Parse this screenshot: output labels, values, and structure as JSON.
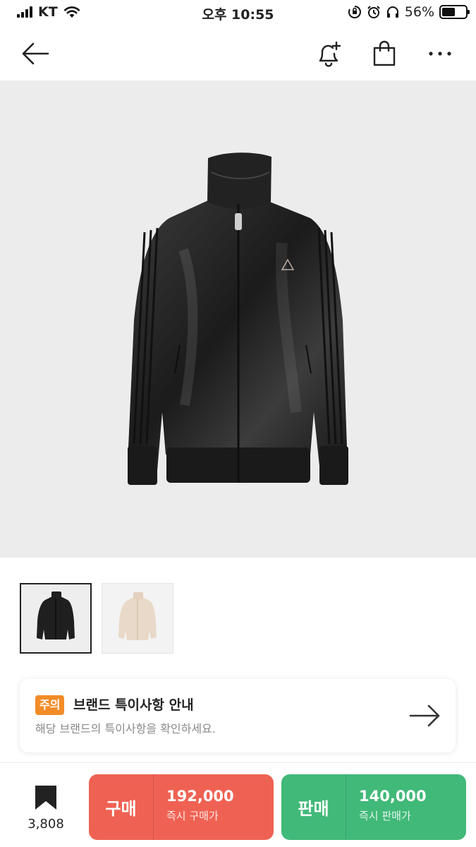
{
  "status_bar": {
    "carrier": "KT",
    "time": "오후 10:55",
    "battery": "56%",
    "battery_level": 0.56
  },
  "nav": {
    "back_icon": "arrow-left-icon",
    "alert_icon": "bell-plus-icon",
    "bag_icon": "shopping-bag-icon",
    "more_icon": "more-horizontal-icon"
  },
  "product": {
    "image_icon": "track-jacket-image",
    "thumbnails": [
      {
        "icon": "black-jacket-thumbnail",
        "selected": true
      },
      {
        "icon": "beige-jacket-thumbnail",
        "selected": false
      }
    ]
  },
  "notice": {
    "badge": "주의",
    "title": "브랜드 특이사항 안내",
    "description": "해당 브랜드의 특이사항을 확인하세요.",
    "arrow_icon": "arrow-right-icon"
  },
  "bottom_bar": {
    "bookmark_icon": "bookmark-icon",
    "bookmark_count": "3,808",
    "buy": {
      "label": "구매",
      "price": "192,000",
      "sub": "즉시 구매가",
      "color": "#ef6253"
    },
    "sell": {
      "label": "판매",
      "price": "140,000",
      "sub": "즉시 판매가",
      "color": "#41b979"
    }
  },
  "colors": {
    "notice_badge": "#f28c28",
    "hero_background": "#ececec"
  }
}
